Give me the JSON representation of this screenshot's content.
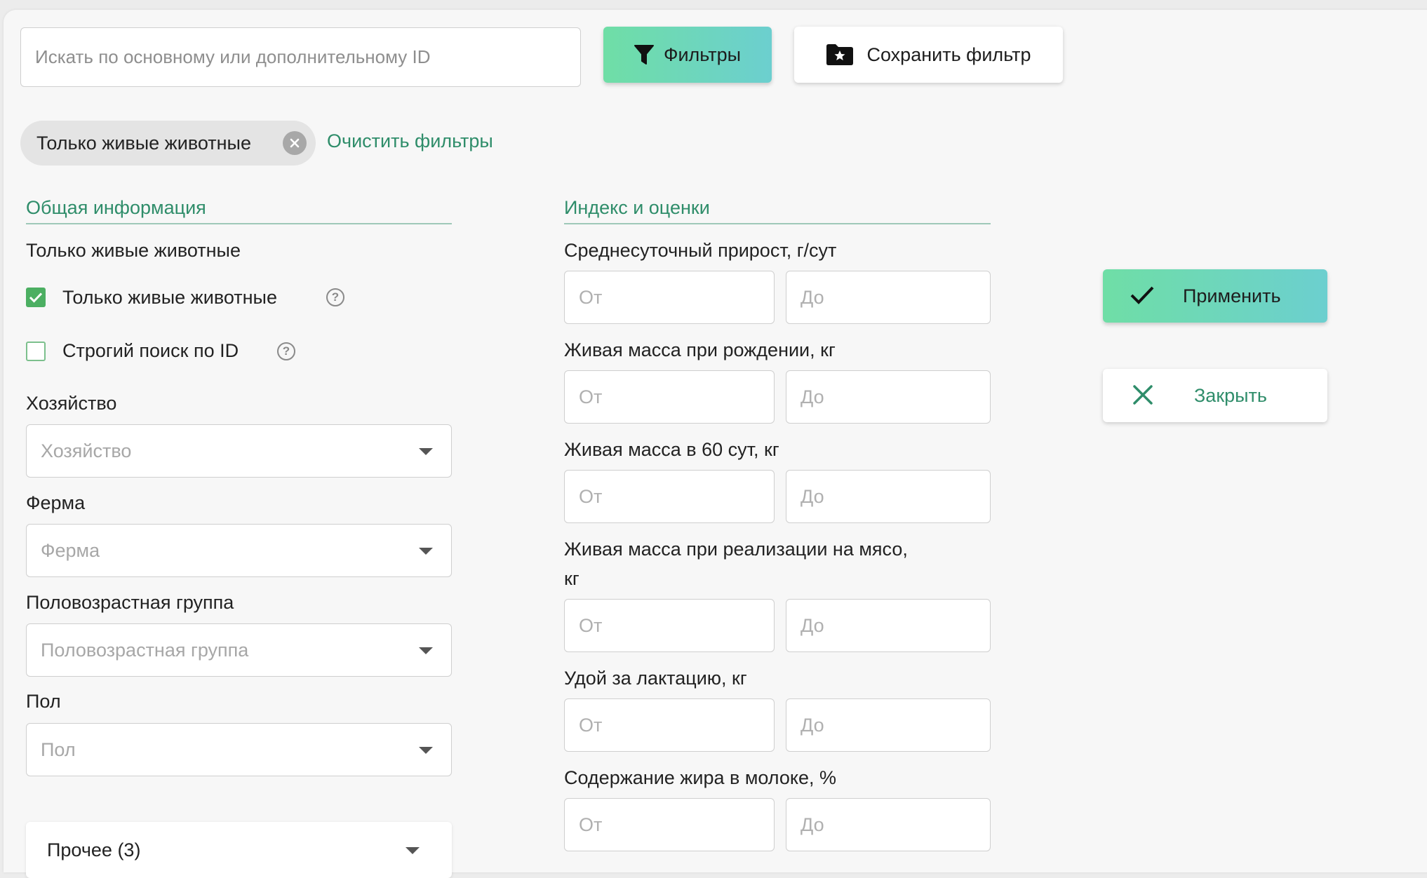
{
  "search": {
    "placeholder": "Искать по основному или дополнительному ID"
  },
  "toolbar": {
    "filters_label": "Фильтры",
    "save_filter_label": "Сохранить фильтр"
  },
  "active_chips": [
    {
      "label": "Только живые животные"
    }
  ],
  "clear_filters_label": "Очистить фильтры",
  "general": {
    "title": "Общая информация",
    "live_only_heading": "Только живые животные",
    "checkboxes": [
      {
        "label": "Только живые животные",
        "checked": true
      },
      {
        "label": "Строгий поиск по ID",
        "checked": false
      }
    ],
    "selects": [
      {
        "label": "Хозяйство",
        "placeholder": "Хозяйство"
      },
      {
        "label": "Ферма",
        "placeholder": "Ферма"
      },
      {
        "label": "Половозрастная группа",
        "placeholder": "Половозрастная группа"
      },
      {
        "label": "Пол",
        "placeholder": "Пол"
      }
    ],
    "other_label": "Прочее (3)"
  },
  "index": {
    "title": "Индекс и оценки",
    "from_placeholder": "От",
    "to_placeholder": "До",
    "ranges": [
      {
        "label": "Среднесуточный прирост, г/сут"
      },
      {
        "label": "Живая масса при рождении, кг"
      },
      {
        "label": "Живая масса в 60 сут, кг"
      },
      {
        "label_line1": "Живая масса при реализации на мясо,",
        "label_line2": "кг"
      },
      {
        "label": "Удой за лактацию, кг"
      },
      {
        "label": "Содержание жира в молоке, %"
      }
    ]
  },
  "actions": {
    "apply_label": "Применить",
    "close_label": "Закрыть"
  },
  "colors": {
    "accent": "#2f8d6a",
    "gradient_start": "#6fdea6",
    "gradient_end": "#6ccfcf",
    "checkbox": "#4caf62"
  }
}
